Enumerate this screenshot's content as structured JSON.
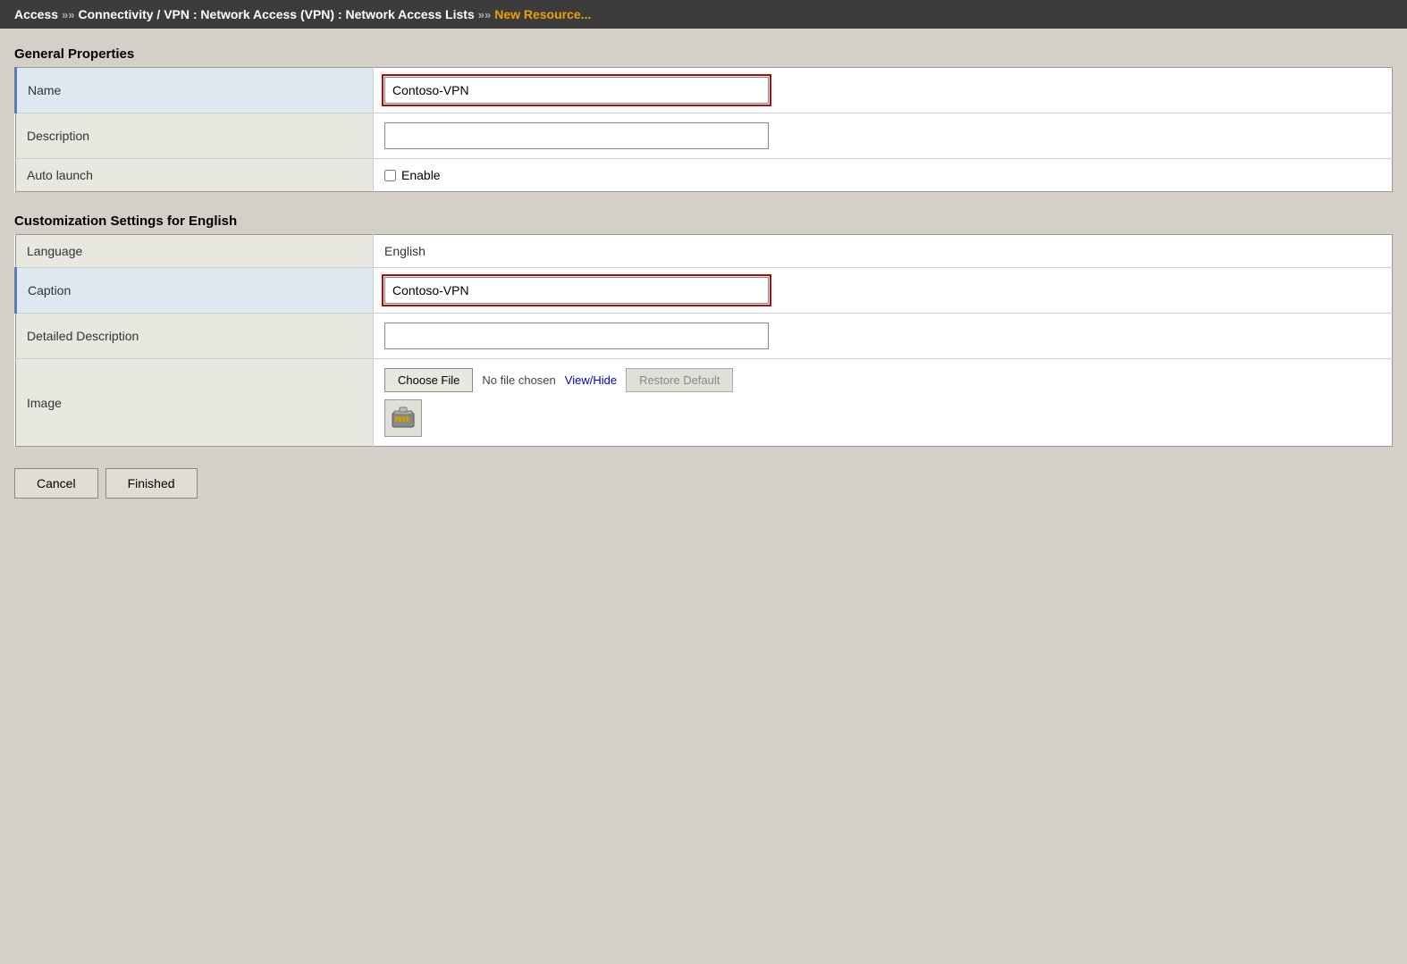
{
  "topbar": {
    "breadcrumb": [
      {
        "label": "Access",
        "type": "normal"
      },
      {
        "label": "»",
        "type": "separator"
      },
      {
        "label": "Connectivity / VPN : Network Access (VPN) : Network Access Lists",
        "type": "normal"
      },
      {
        "label": "»",
        "type": "separator"
      },
      {
        "label": "New Resource...",
        "type": "highlight"
      }
    ]
  },
  "general_properties": {
    "title": "General Properties",
    "fields": [
      {
        "label": "Name",
        "type": "input",
        "value": "Contoso-VPN",
        "highlighted": true
      },
      {
        "label": "Description",
        "type": "input",
        "value": "",
        "highlighted": false
      },
      {
        "label": "Auto launch",
        "type": "checkbox",
        "checkbox_label": "Enable"
      }
    ]
  },
  "customization_settings": {
    "title": "Customization Settings for English",
    "fields": [
      {
        "label": "Language",
        "type": "readonly",
        "value": "English"
      },
      {
        "label": "Caption",
        "type": "input",
        "value": "Contoso-VPN",
        "highlighted": true
      },
      {
        "label": "Detailed Description",
        "type": "input",
        "value": "",
        "highlighted": false
      },
      {
        "label": "Image",
        "type": "image"
      }
    ]
  },
  "image_controls": {
    "choose_file_label": "Choose File",
    "no_file_text": "No file chosen",
    "view_hide_label": "View/Hide",
    "restore_default_label": "Restore Default"
  },
  "buttons": {
    "cancel_label": "Cancel",
    "finished_label": "Finished"
  }
}
